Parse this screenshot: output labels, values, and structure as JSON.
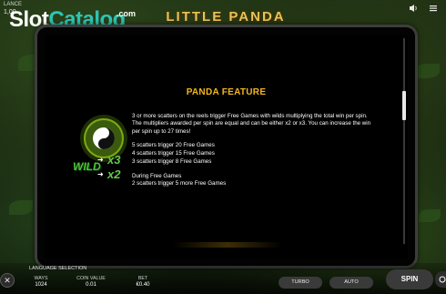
{
  "header": {
    "balance_label": "LANCE",
    "balance_value": "1,00",
    "game_title": "LITTLE PANDA",
    "watermark": {
      "slot": "Slot",
      "catalog": "Catalog",
      "com": ".com"
    }
  },
  "paytable": {
    "title": "PANDA FEATURE",
    "description": "3 or more scatters on the reels trigger Free Games with wilds multiplying the total win per spin. The multipliers awarded per spin are equal and can be either x2 or x3. You can increase the win per spin up to 27 times!",
    "triggers": [
      "5 scatters trigger 20 Free Games",
      "4 scatters trigger 15 Free Games",
      "3 scatters trigger 8 Free Games"
    ],
    "during_heading": "During Free Games",
    "during_text": "2 scatters trigger 5 more Free Games",
    "symbol": {
      "wild": "WILD",
      "x3": "x3",
      "x2": "x2",
      "icon": "yin-yang-icon"
    }
  },
  "bottom": {
    "language_selection": "LANGUAGE SELECTION",
    "ways_label": "WAYS",
    "ways_value": "1024",
    "coin_label": "COIN VALUE",
    "coin_value": "0.01",
    "bet_label": "BET",
    "bet_value": "€0.40",
    "turbo": "TURBO",
    "auto": "AUTO",
    "spin": "SPIN"
  },
  "icons": {
    "close": "close-icon",
    "info": "info-icon",
    "sound": "sound-icon",
    "menu": "menu-icon"
  },
  "colors": {
    "accent": "#f2b61e",
    "wild_green": "#4fbf3a",
    "panel_bg": "#000000"
  }
}
